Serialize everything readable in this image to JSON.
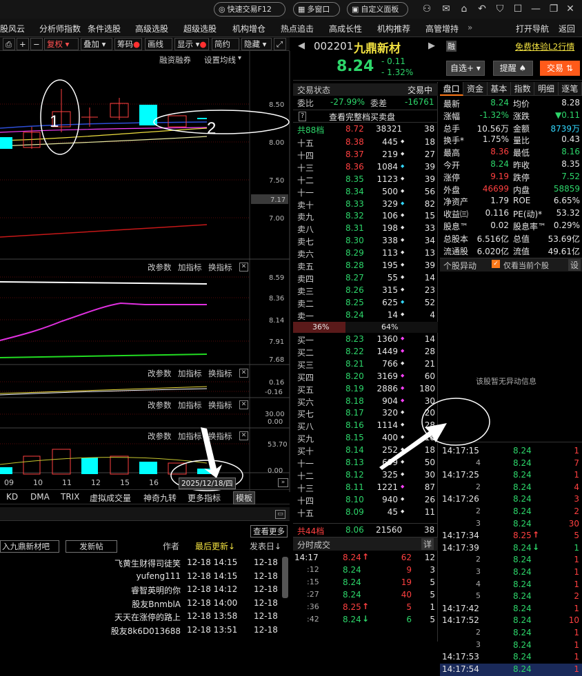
{
  "topbar": {
    "quick_trade": "快速交易F12",
    "multi_window": "多窗口",
    "custom_panel": "自定义面板"
  },
  "menubar": {
    "items": [
      "股风云",
      "分析师指数",
      "条件选股",
      "高级选股",
      "超级选股",
      "机构增仓",
      "热点追击",
      "高成长性",
      "机构推荐",
      "高管增持"
    ],
    "more": "»",
    "nav": "打开导航",
    "back": "返回"
  },
  "chart_toolbar": {
    "items": [
      "复权",
      "叠加",
      "筹码",
      "画线",
      "显示",
      "简约",
      "隐藏"
    ],
    "sub_links": [
      "融资融券",
      "设置均线"
    ]
  },
  "price_axis": [
    "8.50",
    "8.00",
    "7.50",
    "7.17",
    "7.00"
  ],
  "panel2": {
    "links": [
      "改参数",
      "加指标",
      "换指标"
    ],
    "axis": [
      "8.59",
      "8.36",
      "8.14",
      "7.91",
      "7.68"
    ]
  },
  "panel3": {
    "links": [
      "改参数",
      "加指标",
      "换指标"
    ],
    "axis": [
      "0.16",
      "-0.16"
    ]
  },
  "panel4": {
    "links": [
      "改参数",
      "加指标",
      "换指标"
    ],
    "axis": [
      "30.00",
      "0.00"
    ]
  },
  "panel5": {
    "links": [
      "改参数",
      "加指标",
      "换指标"
    ],
    "axis": [
      "53.70",
      "0.00"
    ]
  },
  "date_labels": [
    "09",
    "10",
    "11",
    "12",
    "15",
    "16"
  ],
  "cursor_date": "2025/12/18/四",
  "indicator_tabs": [
    "KD",
    "DMA",
    "TRIX",
    "虚拟成交量",
    "神奇九转",
    "更多指标",
    "模板"
  ],
  "annotations": [
    "1",
    "2"
  ],
  "forum": {
    "more": "查看更多",
    "bar_name": "入九鼎新材吧",
    "post": "发新帖",
    "hdr_author": "作者",
    "hdr_updated": "最后更新↓",
    "hdr_post": "发表日↓",
    "posts": [
      {
        "author": "飞黄生财得司徒笑",
        "updated": "12-18 14:15",
        "date": "12-18"
      },
      {
        "author": "yufeng111",
        "updated": "12-18 14:15",
        "date": "12-18"
      },
      {
        "author": "睿智英明的你",
        "updated": "12-18 14:12",
        "date": "12-18"
      },
      {
        "author": "股友BnmblA",
        "updated": "12-18 14:00",
        "date": "12-18"
      },
      {
        "author": "天天在涨停的路上",
        "updated": "12-18 13:58",
        "date": "12-18"
      },
      {
        "author": "股友8k6D013688",
        "updated": "12-18 13:51",
        "date": "12-18"
      }
    ]
  },
  "stock": {
    "code": "002201",
    "name": "九鼎新材",
    "rong": "融",
    "l2": "免费体验L2行情",
    "price": "8.24",
    "change": "- 0.11",
    "pct": "- 1.32%",
    "btn_watch": "自选+",
    "btn_alert": "提醒",
    "btn_trade": "交易"
  },
  "trade_status": {
    "label": "交易状态",
    "value": "交易中",
    "weibi_l": "委比",
    "weibi": "-27.99%",
    "weicha_l": "委差",
    "weicha": "-16761",
    "full_book": "查看完整档买卖盘",
    "q": "?"
  },
  "sell_total": {
    "label": "共88档",
    "price": "8.72",
    "vol": "38321",
    "n": "38"
  },
  "sells": [
    {
      "l": "十五",
      "p": "8.38",
      "v": "445",
      "d": "w",
      "n": "18"
    },
    {
      "l": "十四",
      "p": "8.37",
      "v": "219",
      "d": "w",
      "n": "27"
    },
    {
      "l": "十三",
      "p": "8.36",
      "v": "1084",
      "d": "c",
      "n": "39"
    },
    {
      "l": "十二",
      "p": "8.35",
      "v": "1123",
      "d": "w",
      "n": "39"
    },
    {
      "l": "十一",
      "p": "8.34",
      "v": "500",
      "d": "w",
      "n": "56"
    },
    {
      "l": "卖十",
      "p": "8.33",
      "v": "329",
      "d": "c",
      "n": "82"
    },
    {
      "l": "卖九",
      "p": "8.32",
      "v": "106",
      "d": "w",
      "n": "15"
    },
    {
      "l": "卖八",
      "p": "8.31",
      "v": "198",
      "d": "w",
      "n": "33"
    },
    {
      "l": "卖七",
      "p": "8.30",
      "v": "338",
      "d": "w",
      "n": "34"
    },
    {
      "l": "卖六",
      "p": "8.29",
      "v": "113",
      "d": "w",
      "n": "13"
    },
    {
      "l": "卖五",
      "p": "8.28",
      "v": "195",
      "d": "w",
      "n": "39"
    },
    {
      "l": "卖四",
      "p": "8.27",
      "v": "55",
      "d": "w",
      "n": "14"
    },
    {
      "l": "卖三",
      "p": "8.26",
      "v": "315",
      "d": "w",
      "n": "23"
    },
    {
      "l": "卖二",
      "p": "8.25",
      "v": "625",
      "d": "c",
      "n": "52"
    },
    {
      "l": "卖一",
      "p": "8.24",
      "v": "14",
      "d": "w",
      "n": "4"
    }
  ],
  "ratio": {
    "left": "36%",
    "right": "64%",
    "left_frac": 0.36
  },
  "buys": [
    {
      "l": "买一",
      "p": "8.23",
      "v": "1360",
      "d": "m",
      "n": "14"
    },
    {
      "l": "买二",
      "p": "8.22",
      "v": "1449",
      "d": "m",
      "n": "28"
    },
    {
      "l": "买三",
      "p": "8.21",
      "v": "766",
      "d": "w",
      "n": "21"
    },
    {
      "l": "买四",
      "p": "8.20",
      "v": "3169",
      "d": "m",
      "n": "60"
    },
    {
      "l": "买五",
      "p": "8.19",
      "v": "2886",
      "d": "m",
      "n": "180"
    },
    {
      "l": "买六",
      "p": "8.18",
      "v": "904",
      "d": "m",
      "n": "30"
    },
    {
      "l": "买七",
      "p": "8.17",
      "v": "320",
      "d": "w",
      "n": "20"
    },
    {
      "l": "买八",
      "p": "8.16",
      "v": "1114",
      "d": "w",
      "n": "28"
    },
    {
      "l": "买九",
      "p": "8.15",
      "v": "400",
      "d": "w",
      "n": "18"
    },
    {
      "l": "买十",
      "p": "8.14",
      "v": "252",
      "d": "w",
      "n": "18"
    },
    {
      "l": "十一",
      "p": "8.13",
      "v": "699",
      "d": "w",
      "n": "50"
    },
    {
      "l": "十二",
      "p": "8.12",
      "v": "325",
      "d": "w",
      "n": "30"
    },
    {
      "l": "十三",
      "p": "8.11",
      "v": "1221",
      "d": "m",
      "n": "87"
    },
    {
      "l": "十四",
      "p": "8.10",
      "v": "940",
      "d": "w",
      "n": "26"
    },
    {
      "l": "十五",
      "p": "8.09",
      "v": "45",
      "d": "w",
      "n": "11"
    }
  ],
  "buy_total": {
    "label": "共44档",
    "price": "8.06",
    "vol": "21560",
    "n": "38"
  },
  "fenshi": {
    "title": "分时成交",
    "detail": "详",
    "rows": [
      {
        "t": "14:17",
        "p": "8.24",
        "a": "up",
        "v": "62",
        "n": "12"
      },
      {
        "t": ":12",
        "p": "8.24",
        "a": "",
        "v": "9",
        "n": "3"
      },
      {
        "t": ":15",
        "p": "8.24",
        "a": "",
        "v": "19",
        "n": "5"
      },
      {
        "t": ":27",
        "p": "8.24",
        "a": "",
        "v": "40",
        "n": "5"
      },
      {
        "t": ":36",
        "p": "8.25",
        "a": "up",
        "v": "5",
        "n": "1"
      },
      {
        "t": ":42",
        "p": "8.24",
        "a": "dn",
        "v": "6",
        "n": "5"
      }
    ]
  },
  "quote_tabs": [
    "盘口",
    "资金",
    "基本",
    "指数",
    "明细",
    "逐笔"
  ],
  "quote": [
    [
      "最新",
      "8.24",
      "g",
      "均价",
      "8.28",
      "w"
    ],
    [
      "涨幅",
      "-1.32%",
      "g",
      "涨跌",
      "▼0.11",
      "g"
    ],
    [
      "总手",
      "10.56万",
      "w",
      "金额",
      "8739万",
      "c"
    ],
    [
      "换手*",
      "1.75%",
      "w",
      "量比",
      "0.43",
      "w"
    ],
    [
      "最高",
      "8.36",
      "r",
      "最低",
      "8.16",
      "g"
    ],
    [
      "今开",
      "8.24",
      "g",
      "昨收",
      "8.35",
      "w"
    ],
    [
      "涨停",
      "9.19",
      "r",
      "跌停",
      "7.52",
      "g"
    ],
    [
      "外盘",
      "46699",
      "r",
      "内盘",
      "58859",
      "g"
    ],
    [
      "净资产",
      "1.79",
      "w",
      "ROE",
      "6.65%",
      "w"
    ],
    [
      "收益㈢",
      "0.116",
      "w",
      "PE(动)*",
      "53.32",
      "w"
    ],
    [
      "股息™",
      "0.02",
      "w",
      "股息率™",
      "0.29%",
      "w"
    ],
    [
      "总股本",
      "6.516亿",
      "w",
      "总值",
      "53.69亿",
      "w"
    ],
    [
      "流通股",
      "6.020亿",
      "w",
      "流值",
      "49.61亿",
      "w"
    ]
  ],
  "anomaly": {
    "title": "个股异动",
    "checkbox": "仅看当前个股",
    "settings": "设",
    "empty": "该股暂无异动信息"
  },
  "ticks": [
    {
      "t": "14:17:15",
      "p": "8.24",
      "a": "",
      "v": "1"
    },
    {
      "t": "4",
      "p": "8.24",
      "a": "",
      "v": "7"
    },
    {
      "t": "14:17:25",
      "p": "8.24",
      "a": "",
      "v": "1"
    },
    {
      "t": "2",
      "p": "8.24",
      "a": "",
      "v": "4"
    },
    {
      "t": "14:17:26",
      "p": "8.24",
      "a": "",
      "v": "3"
    },
    {
      "t": "2",
      "p": "8.24",
      "a": "",
      "v": "2"
    },
    {
      "t": "3",
      "p": "8.24",
      "a": "",
      "v": "30"
    },
    {
      "t": "14:17:34",
      "p": "8.25",
      "a": "up",
      "v": "5"
    },
    {
      "t": "14:17:39",
      "p": "8.24",
      "a": "dn",
      "v": "1"
    },
    {
      "t": "2",
      "p": "8.24",
      "a": "",
      "v": "1"
    },
    {
      "t": "3",
      "p": "8.24",
      "a": "",
      "v": "1"
    },
    {
      "t": "4",
      "p": "8.24",
      "a": "",
      "v": "1"
    },
    {
      "t": "5",
      "p": "8.24",
      "a": "",
      "v": "2"
    },
    {
      "t": "14:17:42",
      "p": "8.24",
      "a": "",
      "v": "1"
    },
    {
      "t": "14:17:52",
      "p": "8.24",
      "a": "",
      "v": "10"
    },
    {
      "t": "2",
      "p": "8.24",
      "a": "",
      "v": "1"
    },
    {
      "t": "3",
      "p": "8.24",
      "a": "",
      "v": "1"
    },
    {
      "t": "14:17:53",
      "p": "8.24",
      "a": "",
      "v": "1"
    },
    {
      "t": "14:17:54",
      "p": "8.24",
      "a": "",
      "v": "1"
    }
  ]
}
